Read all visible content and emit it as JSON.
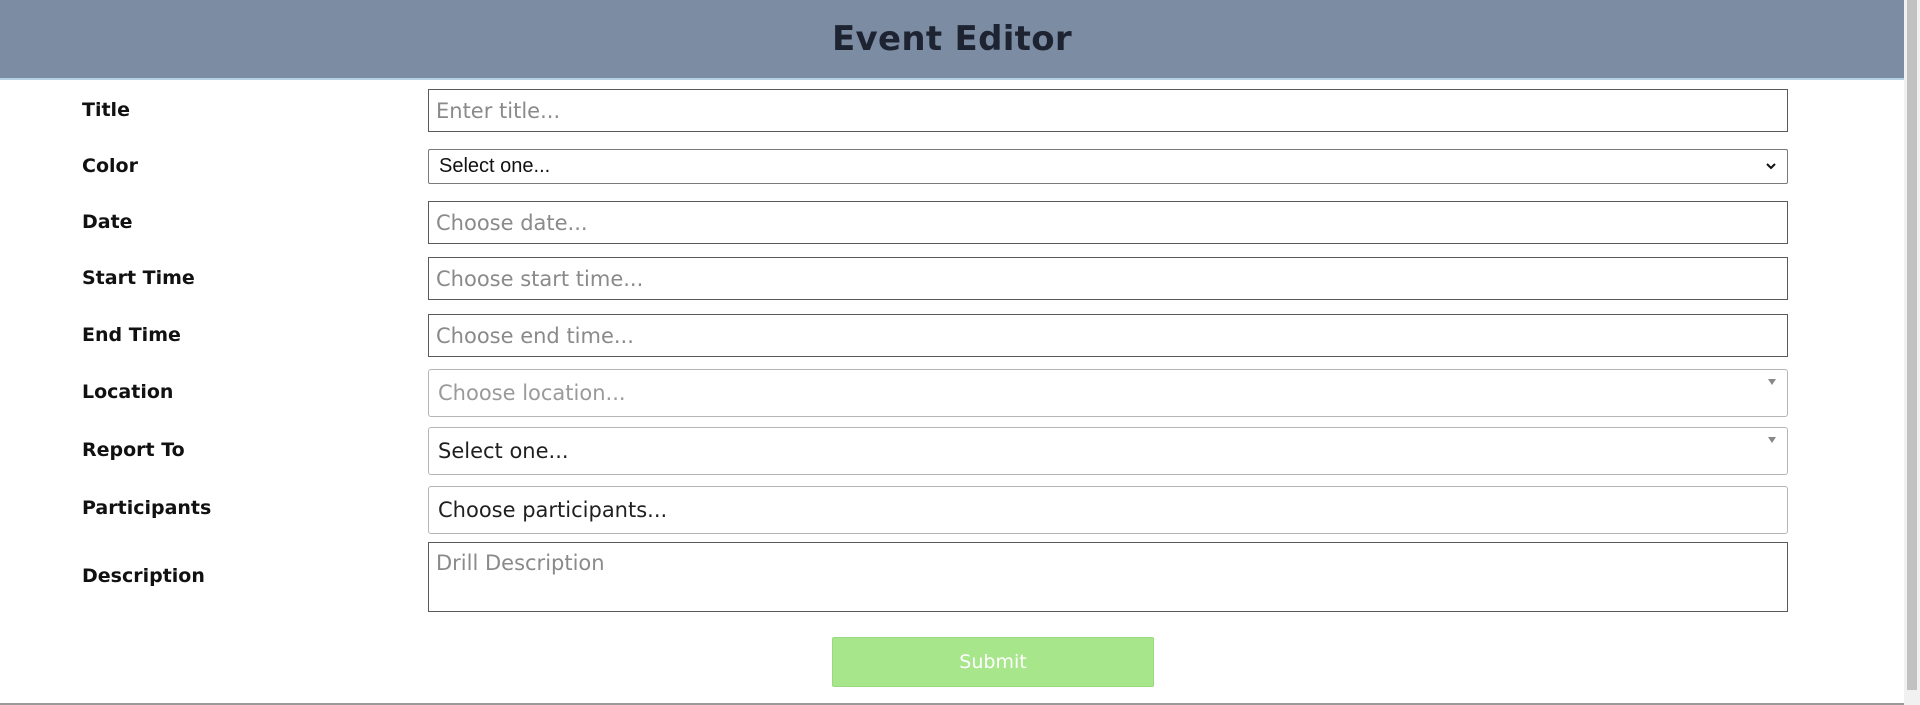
{
  "header": {
    "title": "Event Editor"
  },
  "form": {
    "title_label": "Title",
    "title_placeholder": "Enter title...",
    "color_label": "Color",
    "color_selected": "Select one...",
    "date_label": "Date",
    "date_placeholder": "Choose date...",
    "start_time_label": "Start Time",
    "start_time_placeholder": "Choose start time...",
    "end_time_label": "End Time",
    "end_time_placeholder": "Choose end time...",
    "location_label": "Location",
    "location_placeholder": "Choose location...",
    "report_to_label": "Report To",
    "report_to_selected": "Select one...",
    "participants_label": "Participants",
    "participants_placeholder": "Choose participants...",
    "description_label": "Description",
    "description_placeholder": "Drill Description",
    "submit_label": "Submit"
  },
  "colors": {
    "header_bg": "#7c8da3",
    "submit_bg": "#a7e68b"
  },
  "icons": {
    "color_dropdown": "chevron-down-icon",
    "location_dropdown": "caret-down-icon",
    "report_to_dropdown": "caret-down-icon"
  }
}
